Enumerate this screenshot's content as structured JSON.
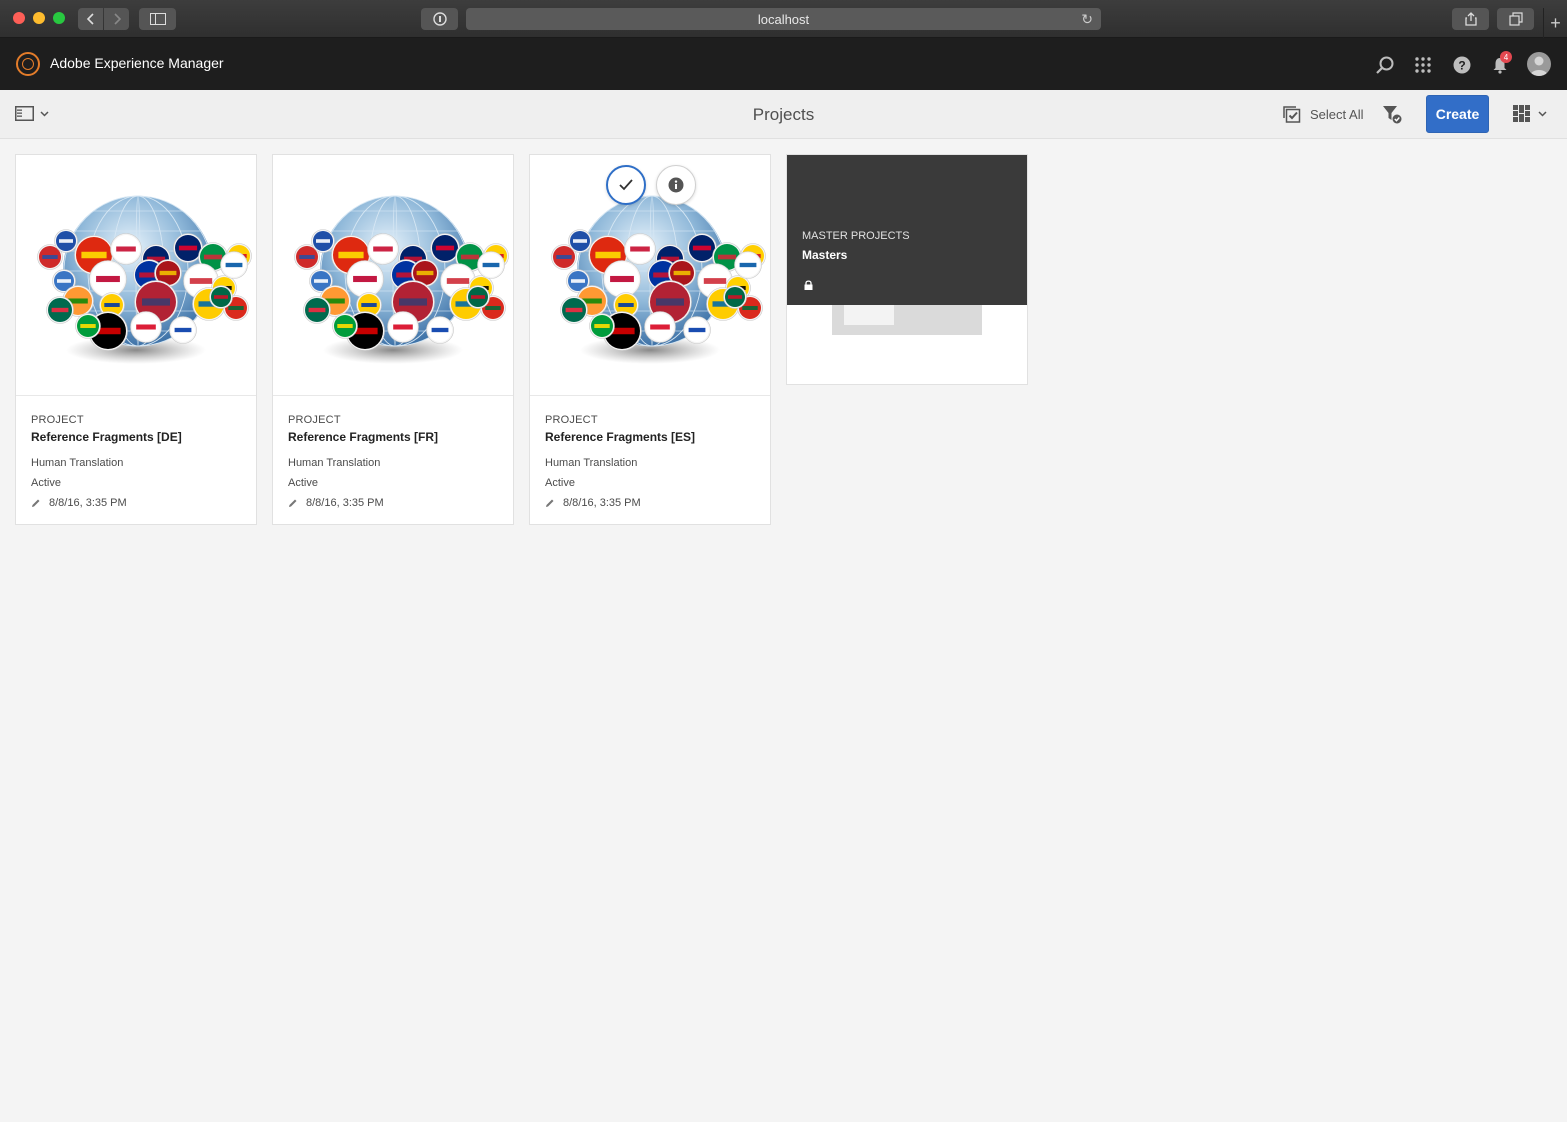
{
  "browser": {
    "address": "localhost"
  },
  "shell": {
    "app_title": "Adobe Experience Manager",
    "notification_count": "4",
    "icons": [
      "search-icon",
      "apps-grid-icon",
      "help-icon",
      "bell-icon",
      "avatar"
    ]
  },
  "actionbar": {
    "page_title": "Projects",
    "select_all": "Select All",
    "create": "Create"
  },
  "cards": [
    {
      "type": "PROJECT",
      "title": "Reference Fragments [DE]",
      "translation": "Human Translation",
      "status": "Active",
      "modified": "8/8/16, 3:35 PM"
    },
    {
      "type": "PROJECT",
      "title": "Reference Fragments [FR]",
      "translation": "Human Translation",
      "status": "Active",
      "modified": "8/8/16, 3:35 PM"
    },
    {
      "type": "PROJECT",
      "title": "Reference Fragments [ES]",
      "translation": "Human Translation",
      "status": "Active",
      "modified": "8/8/16, 3:35 PM"
    }
  ],
  "master": {
    "type": "MASTER PROJECTS",
    "title": "Masters"
  },
  "colors": {
    "accent": "#326ec8",
    "shell": "#1e1e1e",
    "logo": "#e37c2a",
    "badge": "#e34850"
  }
}
